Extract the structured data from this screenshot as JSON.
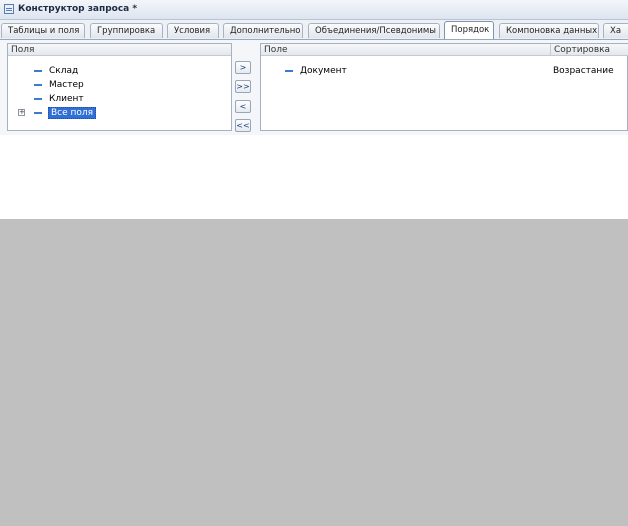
{
  "window": {
    "title": "Конструктор запроса *"
  },
  "tabs": [
    {
      "label": "Таблицы и поля",
      "active": false
    },
    {
      "label": "Группировка",
      "active": false
    },
    {
      "label": "Условия",
      "active": false
    },
    {
      "label": "Дополнительно",
      "active": false
    },
    {
      "label": "Объединения/Псевдонимы",
      "active": false
    },
    {
      "label": "Порядок",
      "active": true
    },
    {
      "label": "Компоновка данных",
      "active": false
    },
    {
      "label": "Ха",
      "active": false
    }
  ],
  "left_panel": {
    "header": "Поля",
    "items": [
      {
        "label": "Склад"
      },
      {
        "label": "Мастер"
      },
      {
        "label": "Клиент"
      },
      {
        "label": "Все поля",
        "expandable": true,
        "selected": true
      }
    ]
  },
  "move_buttons": [
    {
      "label": ">",
      "icon": "move-right-icon"
    },
    {
      "label": ">>",
      "icon": "move-all-right-icon"
    },
    {
      "label": "<",
      "icon": "move-left-icon"
    },
    {
      "label": "<<",
      "icon": "move-all-left-icon"
    }
  ],
  "right_panel": {
    "columns": [
      "Поле",
      "Сортировка"
    ],
    "rows": [
      {
        "field": "Документ",
        "sort": "Возрастание"
      }
    ]
  },
  "colors": {
    "accent": "#2f6fd6",
    "field_icon": "#3d7bd0",
    "background_gray": "#c0c0c0"
  }
}
